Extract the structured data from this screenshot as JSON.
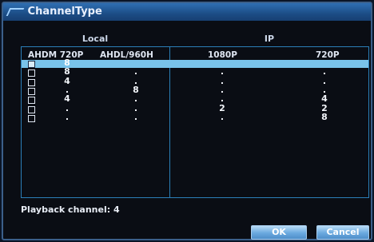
{
  "window": {
    "title": "ChannelType"
  },
  "sections": {
    "local": "Local",
    "ip": "IP"
  },
  "columns": [
    "AHDM 720P",
    "AHDL/960H",
    "1080P",
    "720P"
  ],
  "rows": [
    {
      "checked": true,
      "cells": [
        "8",
        "",
        "",
        ""
      ]
    },
    {
      "checked": false,
      "cells": [
        "8",
        ".",
        ".",
        "."
      ]
    },
    {
      "checked": false,
      "cells": [
        "4",
        ".",
        ".",
        "."
      ]
    },
    {
      "checked": false,
      "cells": [
        ".",
        "8",
        ".",
        "."
      ]
    },
    {
      "checked": false,
      "cells": [
        "4",
        ".",
        ".",
        "4"
      ]
    },
    {
      "checked": false,
      "cells": [
        ".",
        ".",
        "2",
        "2"
      ]
    },
    {
      "checked": false,
      "cells": [
        ".",
        ".",
        ".",
        "8"
      ]
    }
  ],
  "playback": "Playback channel: 4",
  "buttons": {
    "ok": "OK",
    "cancel": "Cancel"
  }
}
